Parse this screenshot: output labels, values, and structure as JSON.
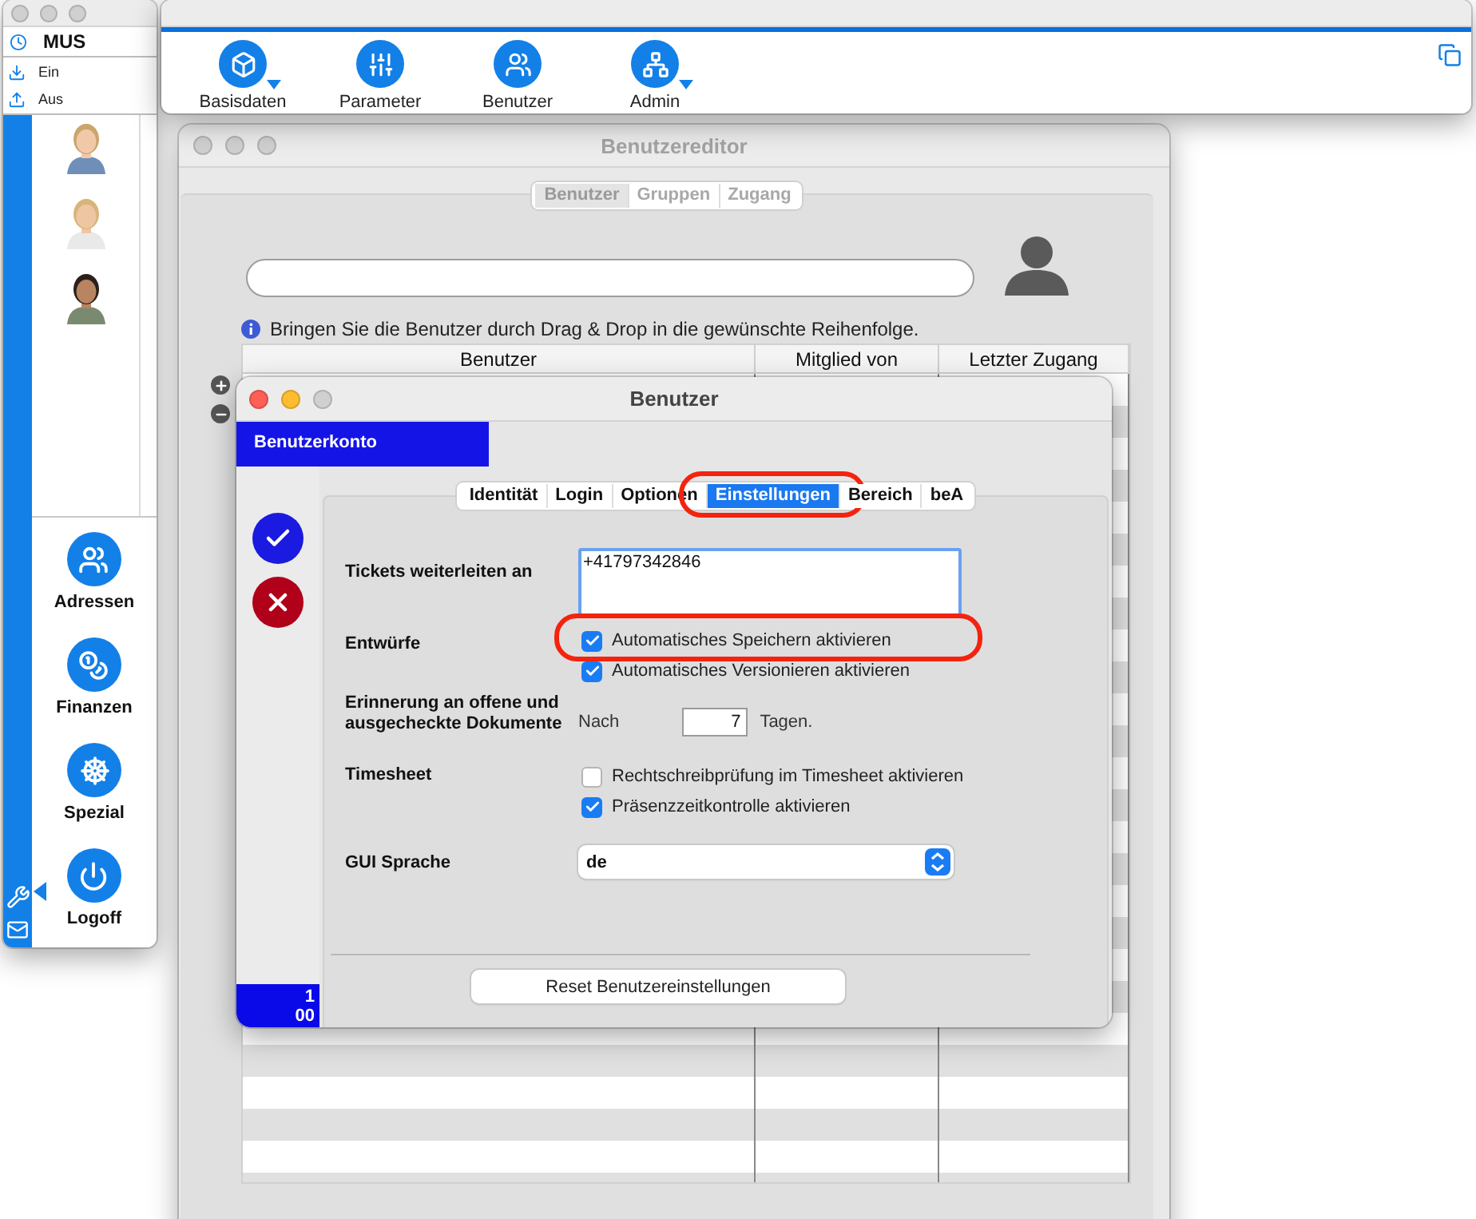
{
  "launcher": {
    "user": "MUS",
    "clock_actions": [
      {
        "label": "Ein",
        "kind": "in"
      },
      {
        "label": "Aus",
        "kind": "out"
      }
    ],
    "modules": [
      {
        "label": "Adressen",
        "kind": "addresses"
      },
      {
        "label": "Finanzen",
        "kind": "finance"
      },
      {
        "label": "Spezial",
        "kind": "special"
      },
      {
        "label": "Logoff",
        "kind": "power"
      }
    ]
  },
  "toolbar": {
    "items": [
      {
        "label": "Basisdaten",
        "kind": "cube",
        "menu": true
      },
      {
        "label": "Parameter",
        "kind": "sliders",
        "menu": false
      },
      {
        "label": "Benutzer",
        "kind": "users",
        "menu": false
      },
      {
        "label": "Admin",
        "kind": "hierarchy",
        "menu": true
      }
    ]
  },
  "editor": {
    "title": "Benutzereditor",
    "tabs": [
      {
        "label": "Benutzer",
        "selected": true
      },
      {
        "label": "Gruppen",
        "selected": false
      },
      {
        "label": "Zugang",
        "selected": false
      }
    ],
    "info": "Bringen Sie die Benutzer durch Drag & Drop in die gewünschte Reihenfolge.",
    "columns": [
      "Benutzer",
      "Mitglied von",
      "Letzter Zugang"
    ]
  },
  "dialog": {
    "title": "Benutzer",
    "section": "Benutzerkonto",
    "counter_lines": [
      "1",
      "00"
    ],
    "tabs": [
      {
        "label": "Identität",
        "selected": false,
        "highlighted": false
      },
      {
        "label": "Login",
        "selected": false,
        "highlighted": false
      },
      {
        "label": "Optionen",
        "selected": false,
        "highlighted": false
      },
      {
        "label": "Einstellungen",
        "selected": true,
        "highlighted": true
      },
      {
        "label": "Bereich",
        "selected": false,
        "highlighted": false
      },
      {
        "label": "beA",
        "selected": false,
        "highlighted": false
      }
    ],
    "forward": {
      "label": "Tickets weiterleiten an",
      "value": "+41797342846"
    },
    "drafts": {
      "label": "Entwürfe",
      "options": [
        {
          "label": "Automatisches Speichern aktivieren",
          "checked": true,
          "highlighted": true
        },
        {
          "label": "Automatisches Versionieren aktivieren",
          "checked": true,
          "highlighted": false
        }
      ]
    },
    "reminder": {
      "label": "Erinnerung an offene und ausgecheckte Dokumente",
      "prefix": "Nach",
      "value": "7",
      "suffix": "Tagen."
    },
    "timesheet": {
      "label": "Timesheet",
      "options": [
        {
          "label": "Rechtschreibprüfung im Timesheet aktivieren",
          "checked": false,
          "highlighted": false
        },
        {
          "label": "Präsenzzeitkontrolle aktivieren",
          "checked": true,
          "highlighted": false
        }
      ]
    },
    "language": {
      "label": "GUI Sprache",
      "value": "de"
    },
    "reset_button": "Reset Benutzereinstellungen"
  }
}
